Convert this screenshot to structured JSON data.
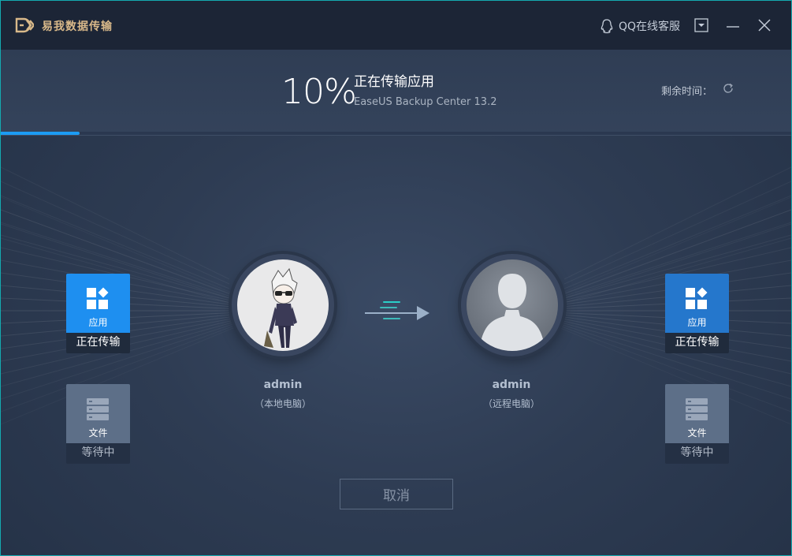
{
  "app": {
    "title": "易我数据传输",
    "logo_icon": "easeus-logo-icon"
  },
  "titlebar": {
    "qq_service": "QQ在线客服",
    "icons": [
      "qq-icon",
      "dropdown-menu-icon",
      "minimize-icon",
      "close-icon"
    ]
  },
  "progress": {
    "percent_text": "10%",
    "percent_value": 10,
    "status": "正在传输应用",
    "current_item": "EaseUS Backup Center 13.2",
    "remaining_label": "剩余时间：",
    "accent_color": "#1c9cf4"
  },
  "source": {
    "cards": [
      {
        "label": "应用",
        "status": "正在传输",
        "icon": "apps-icon",
        "state": "active"
      },
      {
        "label": "文件",
        "status": "等待中",
        "icon": "files-icon",
        "state": "waiting"
      }
    ],
    "user": {
      "name": "admin",
      "role": "（本地电脑）"
    }
  },
  "target": {
    "cards": [
      {
        "label": "应用",
        "status": "正在传输",
        "icon": "apps-icon",
        "state": "active"
      },
      {
        "label": "文件",
        "status": "等待中",
        "icon": "files-icon",
        "state": "waiting"
      }
    ],
    "user": {
      "name": "admin",
      "role": "（远程电脑）"
    }
  },
  "actions": {
    "cancel": "取消"
  }
}
